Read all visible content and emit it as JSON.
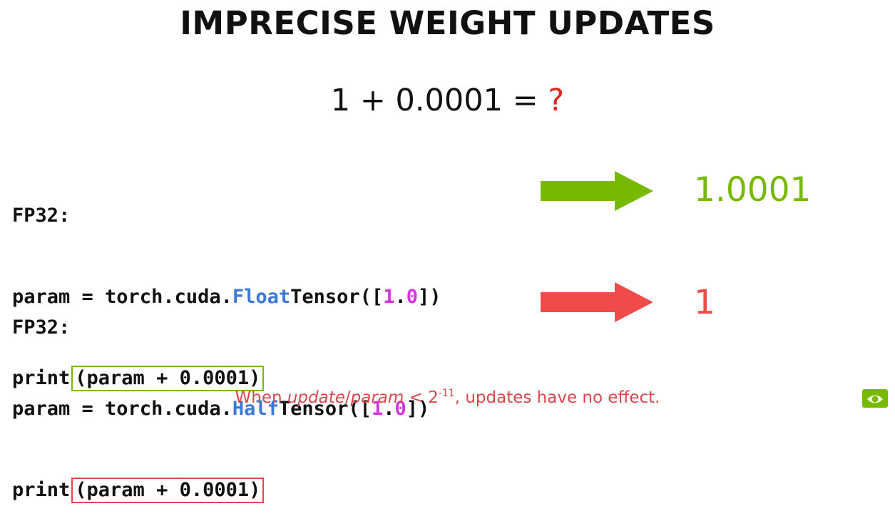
{
  "slide": {
    "title": "IMPRECISE WEIGHT UPDATES",
    "equation": {
      "left": "1 + 0.0001 =",
      "unknown": "?"
    }
  },
  "examples": [
    {
      "heading": "FP32:",
      "code_line1": {
        "pre": "param = torch.cuda.",
        "type_keyword": "Float",
        "post": "Tensor([",
        "num_int": "1",
        "dot": ".",
        "num_frac": "0",
        "close": "])"
      },
      "code_line2": {
        "pre": "print",
        "boxed": "(param + 0.0001)"
      },
      "result": "1.0001",
      "accent": "#76b900"
    },
    {
      "heading": "FP32:",
      "code_line1": {
        "pre": "param = torch.cuda.",
        "type_keyword": "Half",
        "post": "Tensor([",
        "num_int": "1",
        "dot": ".",
        "num_frac": "0",
        "close": "])"
      },
      "code_line2": {
        "pre": "print",
        "boxed": "(param + 0.0001)"
      },
      "result": "1",
      "accent": "#f04b4b"
    }
  ],
  "footer": {
    "text_before": "When ",
    "emph1": "update",
    "slash": "/",
    "emph2": "param",
    "mid": " < 2",
    "exponent": "-11",
    "text_after": ", updates have no effect."
  },
  "colors": {
    "keyword_blue": "#3c78d8",
    "number_magenta": "#d433e0",
    "question_red": "#e3261f",
    "footer_red": "#d9474b",
    "logo_green": "#76b900"
  },
  "icons": {
    "corner_logo": "nvidia-logo-icon"
  }
}
